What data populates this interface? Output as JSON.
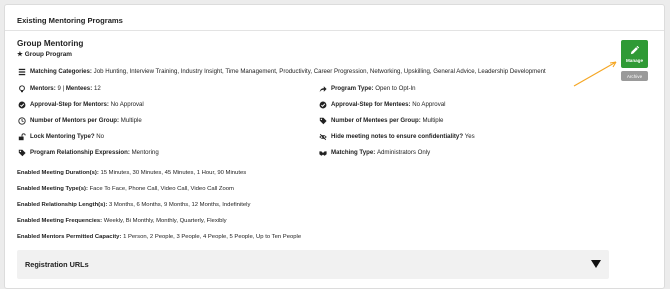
{
  "header": {
    "title": "Existing Mentoring Programs"
  },
  "program": {
    "title": "Group Mentoring",
    "subtitle": "Group Program",
    "categories": {
      "label": "Matching Categories:",
      "value": "Job Hunting, Interview Training, Industry Insight, Time Management, Productivity, Career Progression, Networking, Upskilling, General Advice, Leadership Development"
    },
    "mentors": {
      "label": "Mentors:",
      "value": "9"
    },
    "mentees": {
      "label": "Mentees:",
      "value": "12"
    },
    "program_type": {
      "label": "Program Type:",
      "value": "Open to Opt-In"
    },
    "approval_mentors": {
      "label": "Approval-Step for Mentors:",
      "value": "No Approval"
    },
    "approval_mentees": {
      "label": "Approval-Step for Mentees:",
      "value": "No Approval"
    },
    "mentors_per_group": {
      "label": "Number of Mentors per Group:",
      "value": "Multiple"
    },
    "mentees_per_group": {
      "label": "Number of Mentees per Group:",
      "value": "Multiple"
    },
    "lock_type": {
      "label": "Lock Mentoring Type?",
      "value": "No"
    },
    "hide_notes": {
      "label": "Hide meeting notes to ensure confidentiality?",
      "value": "Yes"
    },
    "relationship_expression": {
      "label": "Program Relationship Expression:",
      "value": "Mentoring"
    },
    "matching_type": {
      "label": "Matching Type:",
      "value": "Administrators Only"
    },
    "meeting_durations": {
      "label": "Enabled Meeting Duration(s):",
      "value": "15 Minutes, 30 Minutes, 45 Minutes, 1 Hour, 90 Minutes"
    },
    "meeting_types": {
      "label": "Enabled Meeting Type(s):",
      "value": "Face To Face, Phone Call, Video Call, Video Call Zoom"
    },
    "relationship_lengths": {
      "label": "Enabled Relationship Length(s):",
      "value": "3 Months, 6 Months, 9 Months, 12 Months, Indefinitely"
    },
    "meeting_frequencies": {
      "label": "Enabled Meeting Frequencies:",
      "value": "Weekly, Bi Monthly, Monthly, Quarterly, Flexibly"
    },
    "mentor_capacity": {
      "label": "Enabled Mentors Permitted Capacity:",
      "value": "1 Person, 2 People, 3 People, 4 People, 5 People, Up to Ten People"
    }
  },
  "buttons": {
    "manage": "Manage",
    "archive": "Archive"
  },
  "registration": {
    "title": "Registration URLs"
  },
  "colors": {
    "manage": "#2f9a35",
    "archive": "#9a9a9a",
    "arrow": "#f5a623"
  }
}
